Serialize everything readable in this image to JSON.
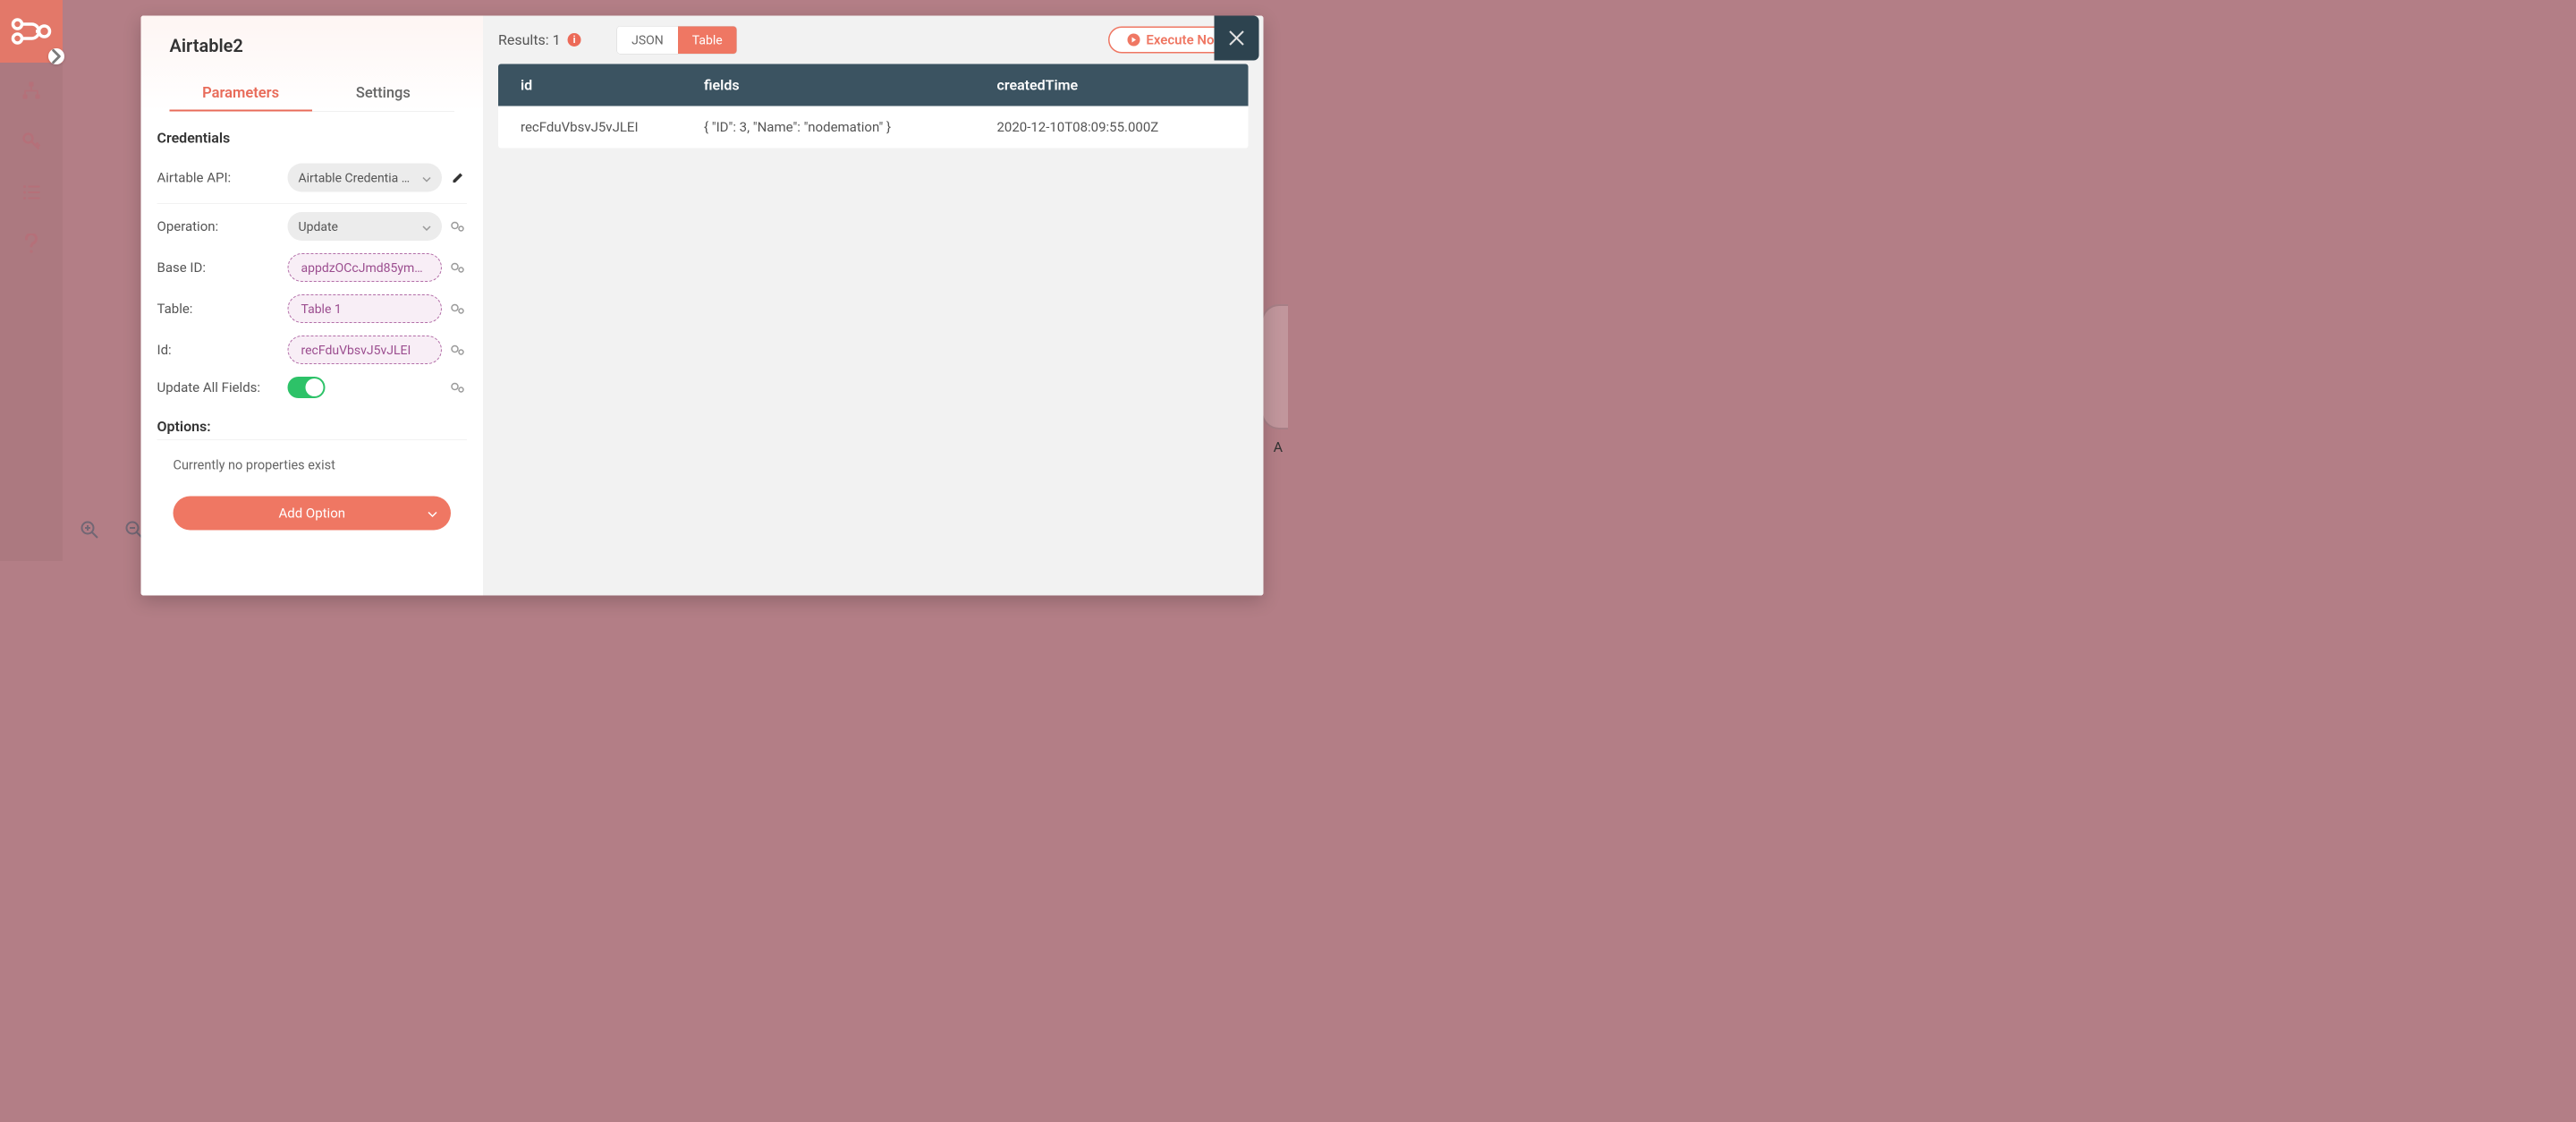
{
  "sidebar": {
    "expand_icon": "▸"
  },
  "modal": {
    "title": "Airtable2",
    "tabs": {
      "parameters": "Parameters",
      "settings": "Settings",
      "active": "parameters"
    },
    "credentials": {
      "heading": "Credentials",
      "api_label": "Airtable API:",
      "api_value": "Airtable Credentia …"
    },
    "params": {
      "operation_label": "Operation:",
      "operation_value": "Update",
      "base_label": "Base ID:",
      "base_value": "appdzOCcJmd85ym…",
      "table_label": "Table:",
      "table_value": "Table 1",
      "id_label": "Id:",
      "id_value": "recFduVbsvJ5vJLEI",
      "update_all_label": "Update All Fields:",
      "update_all_on": true
    },
    "options": {
      "heading": "Options:",
      "no_props": "Currently no properties exist",
      "add_label": "Add Option"
    },
    "results": {
      "label": "Results: 1",
      "view_json": "JSON",
      "view_table": "Table",
      "view_active": "table",
      "execute": "Execute Node",
      "columns": {
        "id": "id",
        "fields": "fields",
        "created": "createdTime"
      },
      "rows": [
        {
          "id": "recFduVbsvJ5vJLEI",
          "fields": "{ \"ID\": 3, \"Name\": \"nodemation\" }",
          "created": "2020-12-10T08:09:55.000Z"
        }
      ]
    }
  },
  "bg": {
    "node_label": "A"
  },
  "colors": {
    "accent": "#ef7763",
    "green": "#2dc268",
    "tableHeader": "#3b5361"
  }
}
